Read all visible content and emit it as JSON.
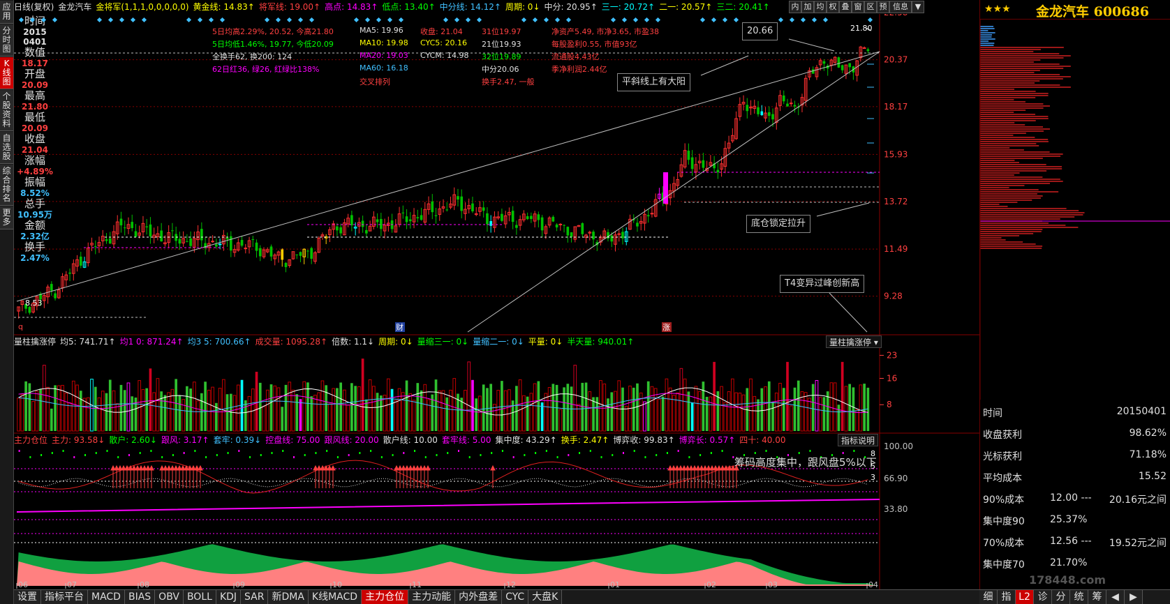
{
  "left_tabs": [
    "应用",
    "分时图",
    "K线图",
    "个股资料",
    "自选股",
    "综合排名",
    "更多"
  ],
  "info": [
    {
      "label": "时间",
      "value": "2015\n0401",
      "color": "#e0e0e0"
    },
    {
      "label": "数值",
      "value": "18.17",
      "color": "#ff4040"
    },
    {
      "label": "开盘",
      "value": "20.09",
      "color": "#ff4040"
    },
    {
      "label": "最高",
      "value": "21.80",
      "color": "#ff4040"
    },
    {
      "label": "最低",
      "value": "20.09",
      "color": "#ff4040"
    },
    {
      "label": "收盘",
      "value": "21.04",
      "color": "#ff4040"
    },
    {
      "label": "涨幅",
      "value": "+4.89%",
      "color": "#ff4040"
    },
    {
      "label": "振幅",
      "value": "8.52%",
      "color": "#40c0ff"
    },
    {
      "label": "总手",
      "value": "10.95万",
      "color": "#40c0ff"
    },
    {
      "label": "金额",
      "value": "2.32亿",
      "color": "#40c0ff"
    },
    {
      "label": "换手",
      "value": "2.47%",
      "color": "#40c0ff"
    }
  ],
  "header": {
    "items": [
      {
        "text": "日线(复权)",
        "color": "#e0e0e0"
      },
      {
        "text": "金龙汽车",
        "color": "#e0e0e0"
      },
      {
        "text": "金将军(1,1,1,0,0,0,0,0)",
        "color": "#ffff00"
      },
      {
        "text": "黄金线: 14.83↑",
        "color": "#ffff00"
      },
      {
        "text": "将军线: 19.00↑",
        "color": "#ff4040"
      },
      {
        "text": "高点: 14.83↑",
        "color": "#ff00ff"
      },
      {
        "text": "低点: 13.40↑",
        "color": "#00ff00"
      },
      {
        "text": "中分线: 14.12↑",
        "color": "#40c0ff"
      },
      {
        "text": "周期: 0↓",
        "color": "#ffff00"
      },
      {
        "text": "中分: 20.95↑",
        "color": "#e0e0e0"
      },
      {
        "text": "三一: 20.72↑",
        "color": "#00ffff"
      },
      {
        "text": "二一: 20.57↑",
        "color": "#ffff00"
      },
      {
        "text": "三二: 20.41↑",
        "color": "#00ff00"
      }
    ],
    "tools": [
      "内",
      "加",
      "均",
      "权",
      "叠",
      "窗",
      "区",
      "预",
      "信息",
      "▼"
    ]
  },
  "annotations": [
    {
      "text": "5日均高2.29%, 20.52, 今高21.80",
      "color": "#ff4040"
    },
    {
      "text": "5日均低1.46%, 19.77, 今低20.09",
      "color": "#00ff00"
    },
    {
      "text": "全换手62, 换200: 124",
      "color": "#e0e0e0"
    },
    {
      "text": "62日红36, 绿26, 红绿比138%",
      "color": "#ff00ff"
    },
    {
      "text": "MA5: 19.96",
      "color": "#e0e0e0"
    },
    {
      "text": "MA10: 19.98",
      "color": "#ffff00"
    },
    {
      "text": "MA20: 19.03",
      "color": "#ff00ff"
    },
    {
      "text": "MA60: 16.18",
      "color": "#40c0ff"
    },
    {
      "text": "交叉排列",
      "color": "#ff4040"
    },
    {
      "text": "收盘: 21.04",
      "color": "#ff4040"
    },
    {
      "text": "CYC5: 20.16",
      "color": "#ffff00"
    },
    {
      "text": "CYCM: 14.98",
      "color": "#e0e0e0"
    },
    {
      "text": "31位19.97",
      "color": "#ff4040"
    },
    {
      "text": "21位19.93",
      "color": "#e0e0e0"
    },
    {
      "text": "32位19.89",
      "color": "#00ff00"
    },
    {
      "text": "中分20.06",
      "color": "#e0e0e0"
    },
    {
      "text": "换手2.47, 一般",
      "color": "#ff4040"
    },
    {
      "text": "净资产5.49, 市净3.65, 市盈38",
      "color": "#ff4040"
    },
    {
      "text": "每股盈利0.55, 市值93亿",
      "color": "#ff4040"
    },
    {
      "text": "流通股4.43亿",
      "color": "#ff4040"
    },
    {
      "text": "季净利润2.44亿",
      "color": "#ff4040"
    }
  ],
  "boxes": {
    "b1": "20.66",
    "b2": "平斜线上有大阳",
    "b3": "底仓锁定拉升",
    "b4": "T4变异过峰创新高",
    "b5": "筹码高度集中，跟风盘5%以下"
  },
  "chart_labels": {
    "high": "21.80",
    "low": "8.53",
    "mark_q": "q",
    "mark_cai": "财",
    "mark_zhang": "涨"
  },
  "chart_data": {
    "type": "candlestick",
    "y_axis_ticks": [
      22.58,
      20.37,
      18.17,
      15.93,
      13.72,
      11.49,
      9.28
    ],
    "ylim": [
      7.6,
      22.58
    ],
    "x_ticks": [
      "06",
      "07",
      "08",
      "09",
      "10",
      "11",
      "12",
      "01",
      "02",
      "03",
      "04"
    ],
    "volume_ticks": [
      23,
      16,
      8
    ],
    "indicator_ticks": [
      "100.00",
      "66.90",
      "33.80"
    ],
    "indicator_side_ticks": [
      "8",
      "5",
      "3"
    ]
  },
  "vol_header": {
    "items": [
      {
        "text": "量柱擒涨停",
        "color": "#e0e0e0"
      },
      {
        "text": "均5: 741.71↑",
        "color": "#e0e0e0"
      },
      {
        "text": "均1 0: 871.24↑",
        "color": "#ff00ff"
      },
      {
        "text": "均3 5: 700.66↑",
        "color": "#40c0ff"
      },
      {
        "text": "成交量: 1095.28↑",
        "color": "#ff4040"
      },
      {
        "text": "倍数: 1.1↓",
        "color": "#e0e0e0"
      },
      {
        "text": "周期: 0↓",
        "color": "#ffff00"
      },
      {
        "text": "量缩三一: 0↓",
        "color": "#00ff00"
      },
      {
        "text": "量缩二一: 0↓",
        "color": "#40c0ff"
      },
      {
        "text": "平量: 0↓",
        "color": "#ffff00"
      },
      {
        "text": "半天量: 940.01↑",
        "color": "#00ff00"
      }
    ],
    "dropdown": "量柱擒涨停 ▾"
  },
  "ind_header": {
    "items": [
      {
        "text": "主力仓位",
        "color": "#ff4040"
      },
      {
        "text": "主力: 93.58↓",
        "color": "#ff4040"
      },
      {
        "text": "散户: 2.60↓",
        "color": "#00ff00"
      },
      {
        "text": "跟风: 3.17↑",
        "color": "#ff00ff"
      },
      {
        "text": "套牢: 0.39↓",
        "color": "#40c0ff"
      },
      {
        "text": "控盘线: 75.00",
        "color": "#ff00ff"
      },
      {
        "text": "跟风线: 20.00",
        "color": "#ff00ff"
      },
      {
        "text": "散户线: 10.00",
        "color": "#e0e0e0"
      },
      {
        "text": "套牢线: 5.00",
        "color": "#ff00ff"
      },
      {
        "text": "集中度: 43.29↑",
        "color": "#e0e0e0"
      },
      {
        "text": "换手: 2.47↑",
        "color": "#ffff00"
      },
      {
        "text": "博弈收: 99.83↑",
        "color": "#e0e0e0"
      },
      {
        "text": "博弈长: 0.57↑",
        "color": "#ff00ff"
      },
      {
        "text": "四十: 40.00",
        "color": "#ff4040"
      }
    ],
    "button": "指标说明"
  },
  "right_panel": {
    "stars": "★★★",
    "name": "金龙汽车 600686",
    "stats": [
      {
        "label": "时间",
        "value": "20150401"
      },
      {
        "label": "收盘获利",
        "value": "98.62%"
      },
      {
        "label": "光标获利",
        "value": "71.18%"
      },
      {
        "label": "平均成本",
        "value": "15.52"
      },
      {
        "label": "90%成本",
        "mid": "12.00 ---",
        "value": "20.16元之间"
      },
      {
        "label": "集中度90",
        "mid": "25.37%",
        "value": ""
      },
      {
        "label": "70%成本",
        "mid": "12.56 ---",
        "value": "19.52元之间"
      },
      {
        "label": "集中度70",
        "mid": "21.70%",
        "value": ""
      }
    ]
  },
  "bottom_tabs": [
    "设置",
    "指标平台",
    "MACD",
    "BIAS",
    "OBV",
    "BOLL",
    "KDJ",
    "SAR",
    "新DMA",
    "K线MACD",
    "主力仓位",
    "主力动能",
    "内外盘差",
    "CYC",
    "大盘K"
  ],
  "bottom_active": "主力仓位",
  "right_bottom_tabs": [
    "细",
    "指",
    "L2",
    "诊",
    "分",
    "统",
    "筹",
    "◀",
    "▶"
  ],
  "right_bottom_active": "L2",
  "watermark": "178448.com"
}
